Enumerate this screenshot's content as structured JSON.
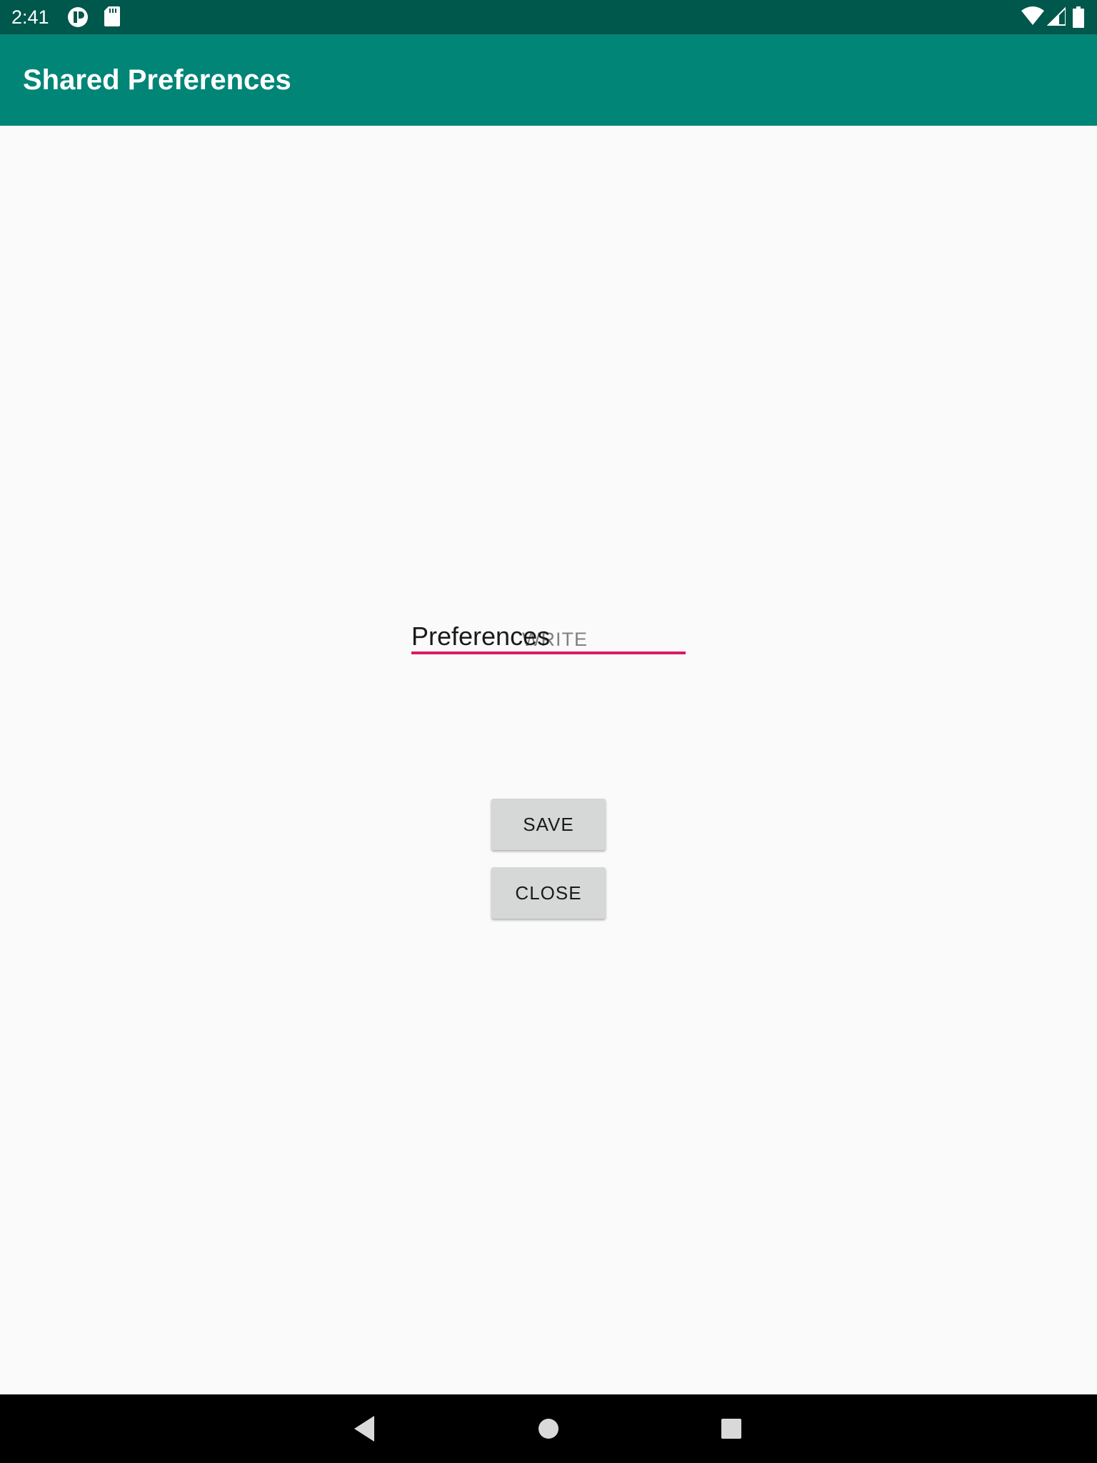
{
  "status_bar": {
    "time": "2:41",
    "icons": [
      "vpn-key-icon",
      "sd-card-icon",
      "wifi-icon",
      "signal-icon",
      "battery-icon"
    ]
  },
  "app_bar": {
    "title": "Shared Preferences",
    "color": "#008577"
  },
  "form": {
    "input_value": "Preferences",
    "hint": "WRITE",
    "underline_color": "#d81b60",
    "save_label": "SAVE",
    "close_label": "CLOSE"
  },
  "nav_bar": {
    "buttons": [
      "back-icon",
      "home-icon",
      "recents-icon"
    ]
  }
}
